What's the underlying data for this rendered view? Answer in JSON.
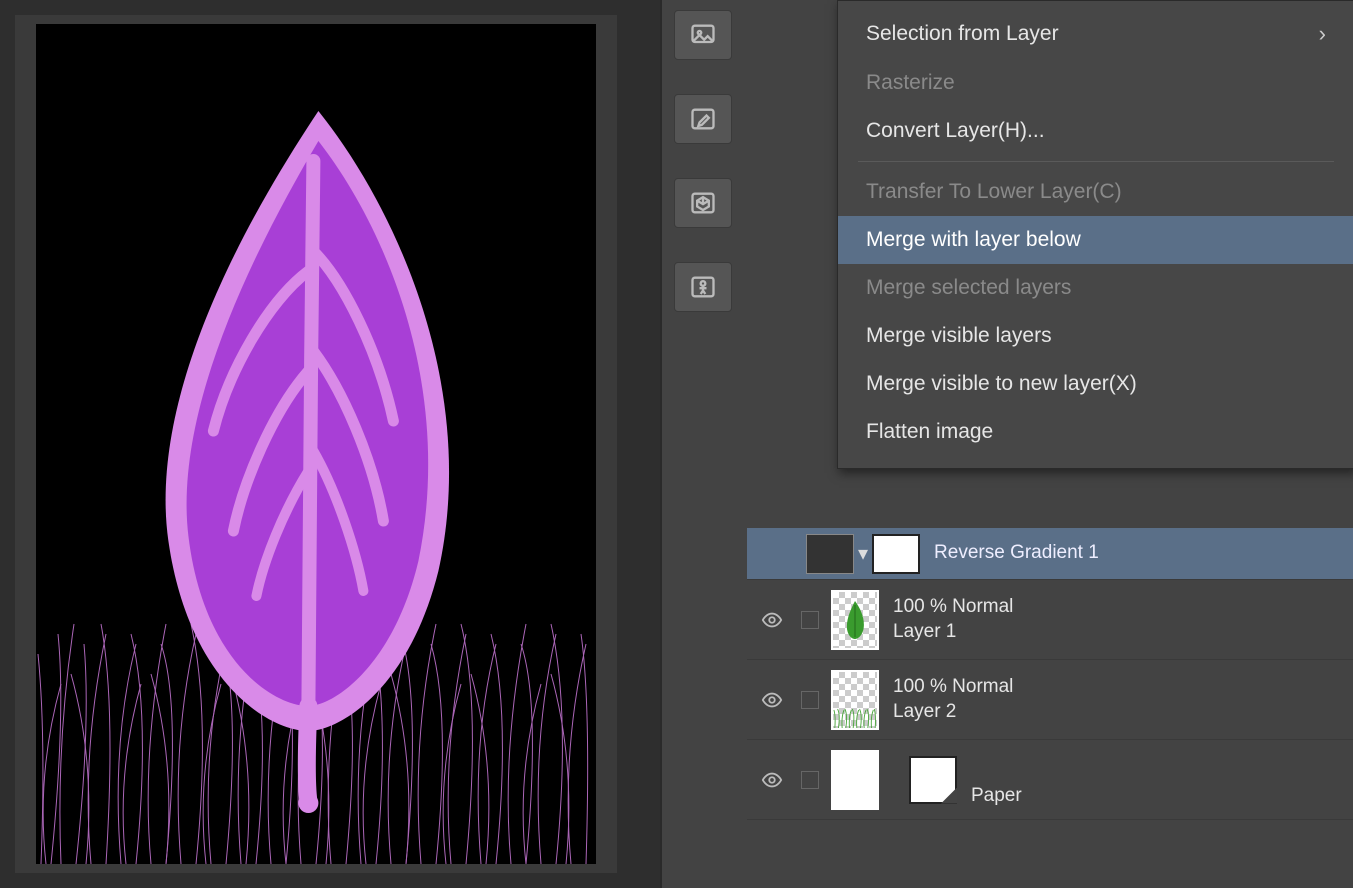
{
  "contextMenu": {
    "selectionFromLayer": "Selection from Layer",
    "rasterize": "Rasterize",
    "convertLayer": "Convert Layer(H)...",
    "transferLower": "Transfer To Lower Layer(C)",
    "mergeBelow": "Merge with layer below",
    "mergeSelected": "Merge selected layers",
    "mergeVisible": "Merge visible layers",
    "mergeVisibleNew": "Merge visible to new layer(X)",
    "flatten": "Flatten image"
  },
  "layers": {
    "reverseGradient": "Reverse Gradient 1",
    "layer1Mode": "100 % Normal",
    "layer1Name": "Layer 1",
    "layer2Mode": "100 % Normal",
    "layer2Name": "Layer 2",
    "paperName": "Paper"
  },
  "peekDigit": "2",
  "colors": {
    "leafFill": "#a83fd6",
    "leafOutline": "#d98ae8",
    "grass": "#c978d8"
  }
}
